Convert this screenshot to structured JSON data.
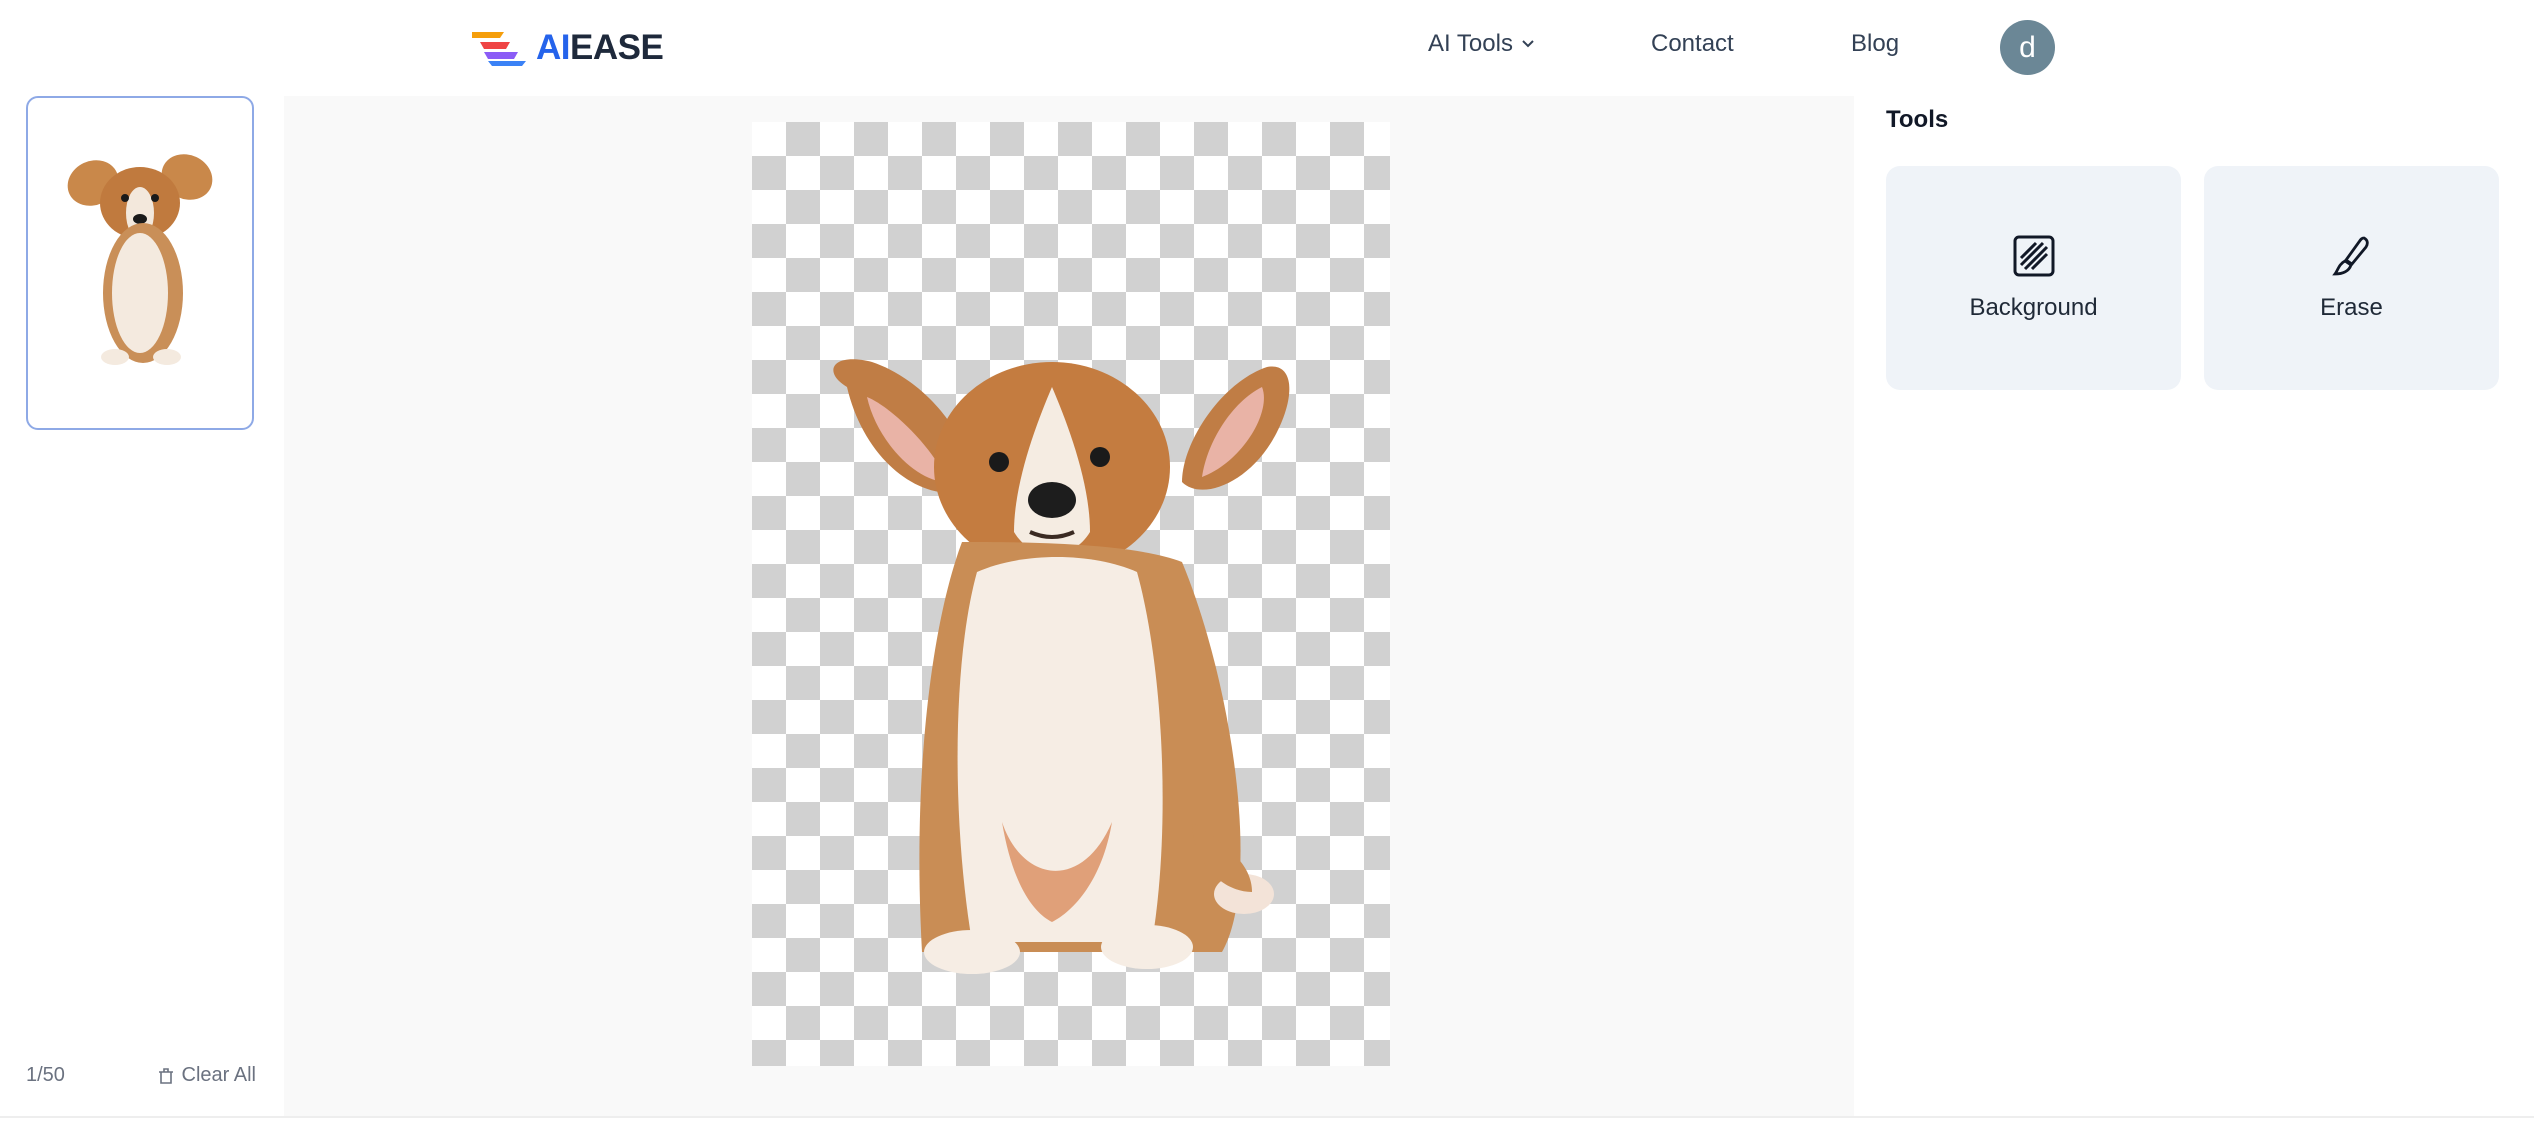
{
  "header": {
    "logo": {
      "text_ai": "AI",
      "text_ease": "EASE",
      "icon": "aiease-logo-icon"
    },
    "nav": {
      "ai_tools": "AI Tools",
      "contact": "Contact",
      "blog": "Blog"
    },
    "avatar_letter": "d"
  },
  "sidebar": {
    "counter": "1/50",
    "clear_all": "Clear All"
  },
  "tools": {
    "title": "Tools",
    "items": [
      {
        "label": "Background",
        "icon": "background-pattern-icon"
      },
      {
        "label": "Erase",
        "icon": "brush-icon"
      }
    ]
  },
  "colors": {
    "brand_blue": "#2563eb",
    "avatar": "#6b8796",
    "tool_card": "#eff3f8",
    "thumb_border": "#8ea9e6"
  }
}
